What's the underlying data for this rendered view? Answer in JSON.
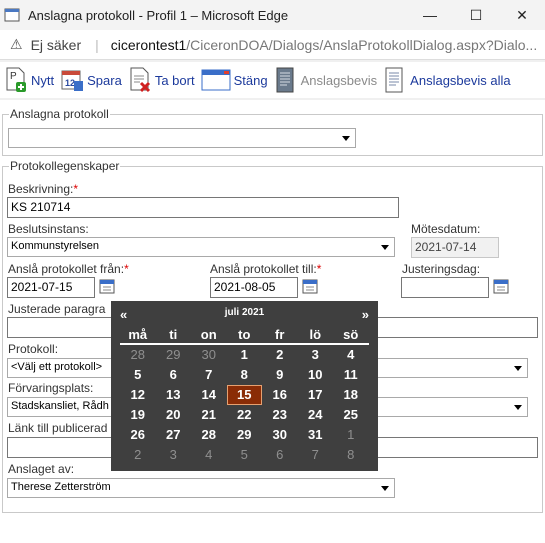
{
  "window": {
    "title": "Anslagna protokoll - Profil 1 – Microsoft Edge",
    "minimize_glyph": "—",
    "maximize_glyph": "☐",
    "close_glyph": "✕"
  },
  "address": {
    "warning_glyph": "⚠",
    "not_safe": "Ej säker",
    "separator": "|",
    "domain": "ciceron​test1",
    "path": "/CiceronDOA/Dialogs/AnslaProtokollDialog.aspx?Dialo..."
  },
  "toolbar": {
    "new": "Nytt",
    "save": "Spara",
    "delete": "Ta bort",
    "close": "Stäng",
    "certificate": "Anslagsbevis",
    "certificate_all": "Anslagsbevis alla"
  },
  "group_published": {
    "legend": "Anslagna protokoll",
    "select_value": ""
  },
  "group_props": {
    "legend": "Protokollegenskaper",
    "description_label": "Beskrivning:",
    "description_value": "KS 210714",
    "body_label": "Beslutsinstans:",
    "body_value": "Kommunstyrelsen",
    "meeting_date_label": "Mötesdatum:",
    "meeting_date_value": "2021-07-14",
    "post_from_label": "Anslå protokollet från:",
    "post_from_value": "2021-07-15",
    "post_to_label": "Anslå protokollet till:",
    "post_to_value": "2021-08-05",
    "adjust_day_label": "Justeringsdag:",
    "adjust_day_value": "",
    "adjusted_label": "Justerade paragra",
    "adjusted_value": "",
    "protocol_label": "Protokoll:",
    "protocol_value": "<Välj ett protokoll>",
    "storage_label": "Förvaringsplats:",
    "storage_value": "Stadskansliet, Rådh",
    "link_label": "Länk till publicerad",
    "link_value": "",
    "posted_by_label": "Anslaget av:",
    "posted_by_value": "Therese Zetterström",
    "required_mark": "*"
  },
  "calendar": {
    "prev": "«",
    "next": "»",
    "month_label": "juli 2021",
    "weekdays": [
      "må",
      "ti",
      "on",
      "to",
      "fr",
      "lö",
      "sö"
    ],
    "weeks": [
      [
        {
          "d": "28",
          "o": true
        },
        {
          "d": "29",
          "o": true
        },
        {
          "d": "30",
          "o": true
        },
        {
          "d": "1"
        },
        {
          "d": "2"
        },
        {
          "d": "3"
        },
        {
          "d": "4"
        }
      ],
      [
        {
          "d": "5"
        },
        {
          "d": "6"
        },
        {
          "d": "7"
        },
        {
          "d": "8"
        },
        {
          "d": "9"
        },
        {
          "d": "10"
        },
        {
          "d": "11"
        }
      ],
      [
        {
          "d": "12"
        },
        {
          "d": "13"
        },
        {
          "d": "14"
        },
        {
          "d": "15",
          "s": true
        },
        {
          "d": "16"
        },
        {
          "d": "17"
        },
        {
          "d": "18"
        }
      ],
      [
        {
          "d": "19"
        },
        {
          "d": "20"
        },
        {
          "d": "21"
        },
        {
          "d": "22"
        },
        {
          "d": "23"
        },
        {
          "d": "24"
        },
        {
          "d": "25"
        }
      ],
      [
        {
          "d": "26"
        },
        {
          "d": "27"
        },
        {
          "d": "28"
        },
        {
          "d": "29"
        },
        {
          "d": "30"
        },
        {
          "d": "31"
        },
        {
          "d": "1",
          "o": true
        }
      ],
      [
        {
          "d": "2",
          "o": true
        },
        {
          "d": "3",
          "o": true
        },
        {
          "d": "4",
          "o": true
        },
        {
          "d": "5",
          "o": true
        },
        {
          "d": "6",
          "o": true
        },
        {
          "d": "7",
          "o": true
        },
        {
          "d": "8",
          "o": true
        }
      ]
    ]
  }
}
